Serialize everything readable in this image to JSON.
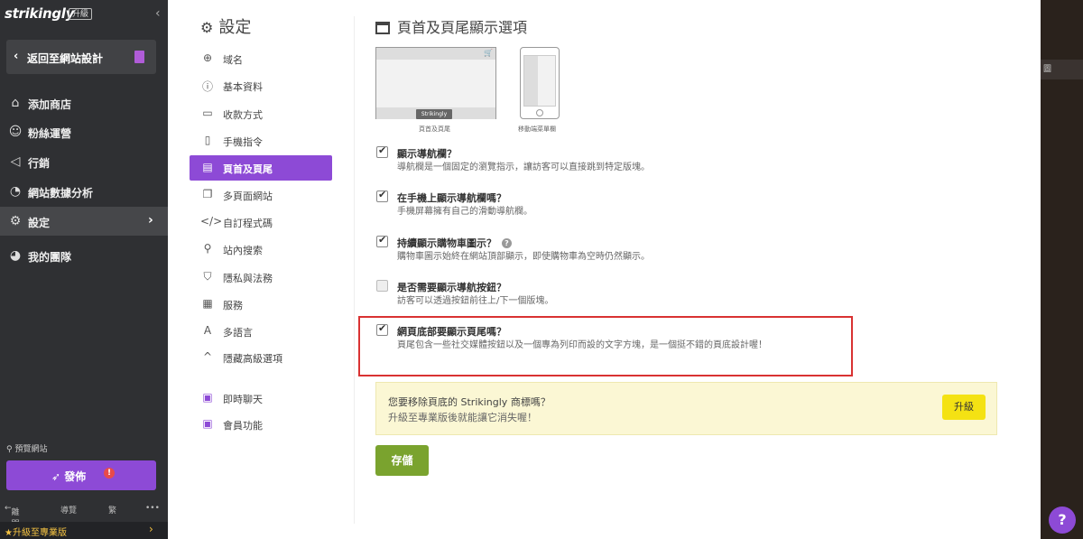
{
  "sidebar": {
    "logo": "strikingly",
    "upgrade_tag": "升級",
    "back_label": "返回至網站設計",
    "items": [
      {
        "label": "添加商店",
        "icon": "store-icon"
      },
      {
        "label": "粉絲運營",
        "icon": "users-icon"
      },
      {
        "label": "行銷",
        "icon": "megaphone-icon"
      },
      {
        "label": "網站數據分析",
        "icon": "pie-chart-icon"
      },
      {
        "label": "設定",
        "icon": "gear-icon"
      },
      {
        "label": "我的團隊",
        "icon": "team-icon"
      }
    ],
    "preview_label": "預覽網站",
    "publish_label": "發佈",
    "publish_alert": "!",
    "bottom_tools": [
      "離開",
      "導覽",
      "繁",
      "•••"
    ],
    "upgrade_bar": "升級至專業版"
  },
  "settings": {
    "title": "設定",
    "menu": [
      {
        "label": "域名",
        "icon": "globe-icon"
      },
      {
        "label": "基本資料",
        "icon": "info-icon"
      },
      {
        "label": "收款方式",
        "icon": "payment-icon"
      },
      {
        "label": "手機指令",
        "icon": "mobile-icon"
      },
      {
        "label": "頁首及頁尾",
        "icon": "layout-icon"
      },
      {
        "label": "多頁面網站",
        "icon": "pages-icon"
      },
      {
        "label": "自訂程式碼",
        "icon": "code-icon"
      },
      {
        "label": "站內搜索",
        "icon": "search-icon"
      },
      {
        "label": "隱私與法務",
        "icon": "shield-icon"
      },
      {
        "label": "服務",
        "icon": "apps-icon"
      },
      {
        "label": "多語言",
        "icon": "language-icon"
      },
      {
        "label": "隱藏高級選項",
        "icon": "chevron-up-icon"
      },
      {
        "label": "即時聊天",
        "icon": "chat-icon"
      },
      {
        "label": "會員功能",
        "icon": "member-icon"
      }
    ]
  },
  "content": {
    "title": "頁首及頁尾顯示選項",
    "desktop_caption": "頁首及頁尾",
    "desktop_badge": "Strikingly",
    "mobile_caption": "移動端菜單欄",
    "options": [
      {
        "title": "顯示導航欄？",
        "desc": "導航欄是一個固定的瀏覽指示，讓訪客可以直接跳到特定版塊。",
        "checked": true
      },
      {
        "title": "在手機上顯示導航欄嗎？",
        "desc": "手機屏幕擁有自己的滑動導航欄。",
        "checked": true
      },
      {
        "title": "持續顯示購物車圖示？",
        "desc": "購物車圖示始終在網站頂部顯示，即使購物車為空時仍然顯示。",
        "checked": true
      },
      {
        "title": "是否需要顯示導航按鈕？",
        "desc": "訪客可以透過按鈕前往上/下一個版塊。",
        "checked": false
      },
      {
        "title": "網頁底部要顯示頁尾嗎？",
        "desc": "頁尾包含一些社交媒體按鈕以及一個專為列印而設的文字方塊，是一個挺不錯的頁底設計喔！",
        "checked": true
      }
    ],
    "help_mark": "?",
    "promo": {
      "line1": "您要移除頁底的 Strikingly 商標嗎？",
      "line2": "升級至專業版後就能讓它消失喔！",
      "button": "升級"
    },
    "save_label": "存儲"
  },
  "right_tab": "圖",
  "help_fab": "?",
  "colors": {
    "accent": "#8d4ad6",
    "save": "#7aa32e",
    "highlight": "#d93232"
  }
}
